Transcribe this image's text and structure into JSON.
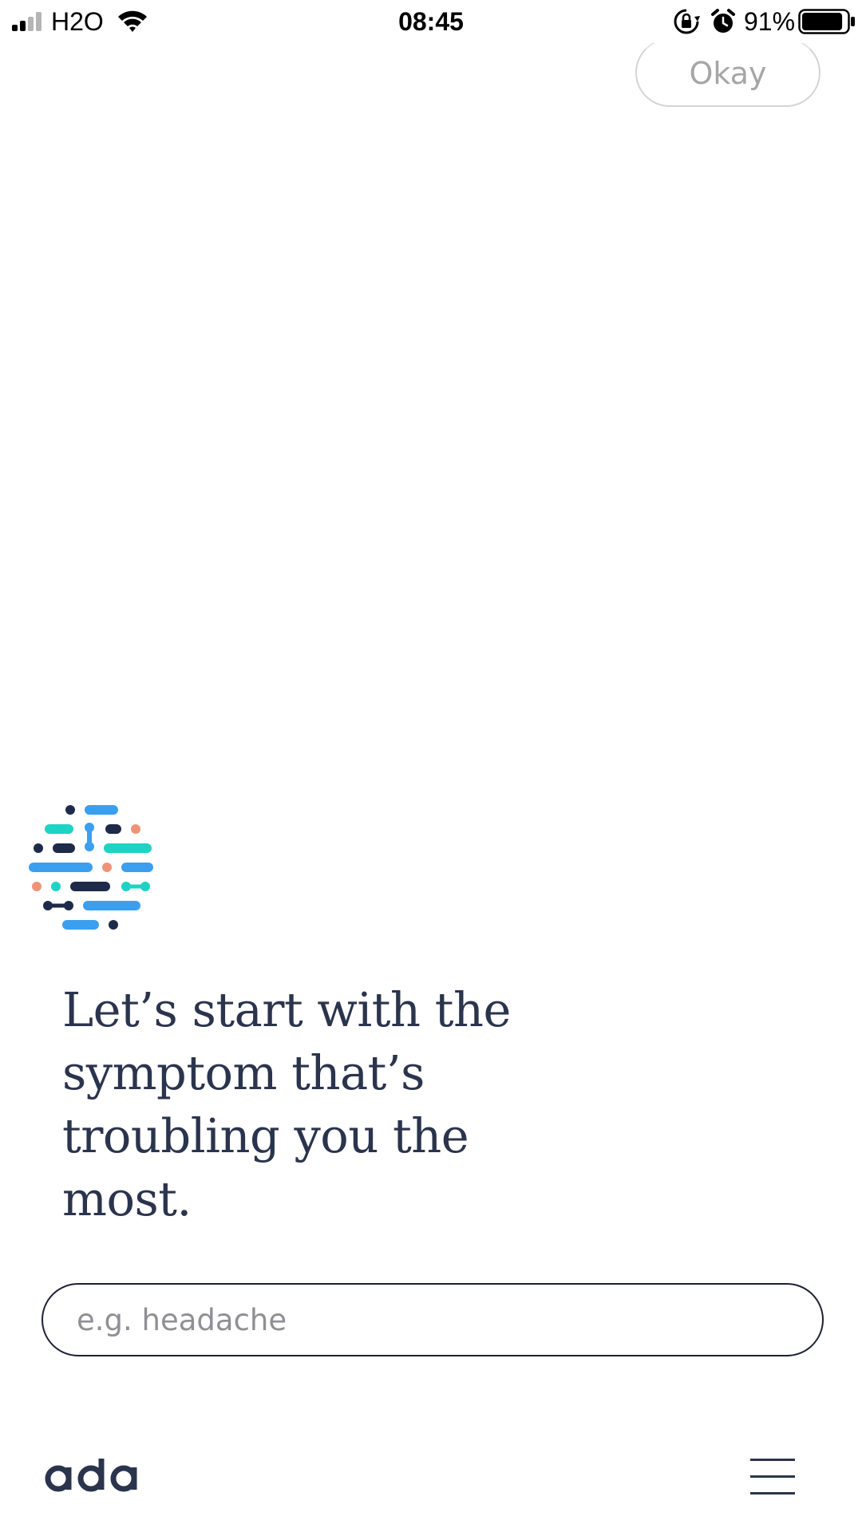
{
  "status_bar": {
    "carrier": "H2O",
    "time": "08:45",
    "battery_percent": "91%",
    "battery_level": 0.91,
    "icons": [
      "signal-icon",
      "wifi-icon",
      "lock-rotation-icon",
      "alarm-icon",
      "battery-icon"
    ]
  },
  "header": {
    "okay_label": "Okay"
  },
  "main": {
    "prompt": "Let’s start with the symptom that’s troubling you the most.",
    "search": {
      "placeholder": "e.g. headache",
      "value": ""
    }
  },
  "footer": {
    "brand": "ada",
    "menu_icon": "hamburger-menu-icon"
  },
  "colors": {
    "text_navy": "#2b344d",
    "dark_navy": "#1e2a4a",
    "blue": "#3b9ff0",
    "teal": "#1dd3c4",
    "salmon": "#ef9378",
    "placeholder_gray": "#8f8f95",
    "okay_gray": "#a6a6a6"
  }
}
